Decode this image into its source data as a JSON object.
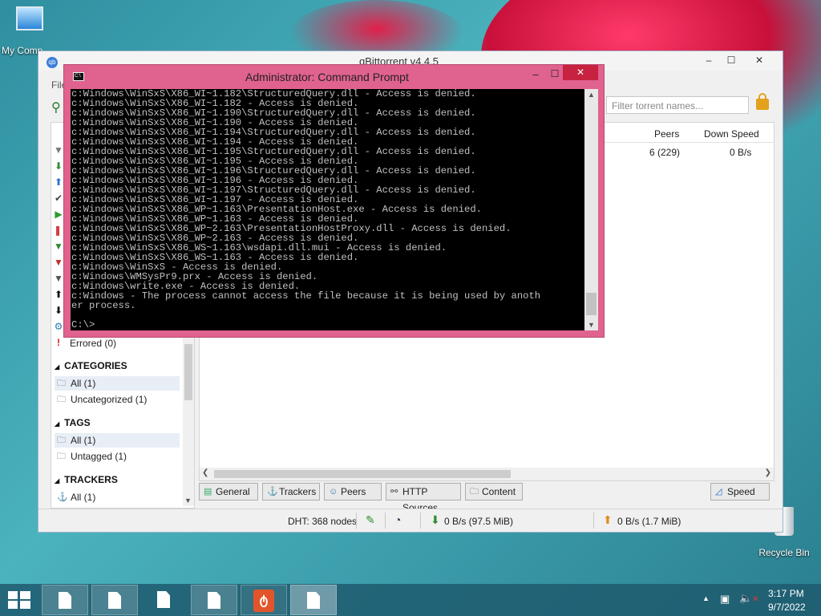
{
  "desktop": {
    "my_computer_label": "My Comp",
    "recycle_bin_label": "Recycle Bin"
  },
  "qbittorrent": {
    "title": "qBittorrent v4.4.5",
    "menu_file": "File",
    "filter_placeholder": "Filter torrent names...",
    "columns": {
      "peers": "Peers",
      "down_speed": "Down Speed"
    },
    "row": {
      "peers": "6 (229)",
      "down_speed": "0 B/s"
    },
    "status_filter_errored": "Errored (0)",
    "categories": {
      "header": "CATEGORIES",
      "items": [
        "All (1)",
        "Uncategorized (1)"
      ]
    },
    "tags": {
      "header": "TAGS",
      "items": [
        "All (1)",
        "Untagged (1)"
      ]
    },
    "trackers": {
      "header": "TRACKERS",
      "items": [
        "All (1)"
      ]
    },
    "tabs": [
      "General",
      "Trackers",
      "Peers",
      "HTTP Sources",
      "Content"
    ],
    "speed_button": "Speed",
    "status": {
      "dht": "DHT: 368 nodes",
      "download": "0 B/s (97.5 MiB)",
      "upload": "0 B/s (1.7 MiB)"
    },
    "colors": {
      "accent_download": "#2e8b2e",
      "accent_upload": "#e08a1e"
    }
  },
  "cmd": {
    "title": "Administrator: Command Prompt",
    "lines": [
      "c:Windows\\WinSxS\\X86_WI~1.182\\StructuredQuery.dll - Access is denied.",
      "c:Windows\\WinSxS\\X86_WI~1.182 - Access is denied.",
      "c:Windows\\WinSxS\\X86_WI~1.190\\StructuredQuery.dll - Access is denied.",
      "c:Windows\\WinSxS\\X86_WI~1.190 - Access is denied.",
      "c:Windows\\WinSxS\\X86_WI~1.194\\StructuredQuery.dll - Access is denied.",
      "c:Windows\\WinSxS\\X86_WI~1.194 - Access is denied.",
      "c:Windows\\WinSxS\\X86_WI~1.195\\StructuredQuery.dll - Access is denied.",
      "c:Windows\\WinSxS\\X86_WI~1.195 - Access is denied.",
      "c:Windows\\WinSxS\\X86_WI~1.196\\StructuredQuery.dll - Access is denied.",
      "c:Windows\\WinSxS\\X86_WI~1.196 - Access is denied.",
      "c:Windows\\WinSxS\\X86_WI~1.197\\StructuredQuery.dll - Access is denied.",
      "c:Windows\\WinSxS\\X86_WI~1.197 - Access is denied.",
      "c:Windows\\WinSxS\\X86_WP~1.163\\PresentationHost.exe - Access is denied.",
      "c:Windows\\WinSxS\\X86_WP~1.163 - Access is denied.",
      "c:Windows\\WinSxS\\X86_WP~2.163\\PresentationHostProxy.dll - Access is denied.",
      "c:Windows\\WinSxS\\X86_WP~2.163 - Access is denied.",
      "c:Windows\\WinSxS\\X86_WS~1.163\\wsdapi.dll.mui - Access is denied.",
      "c:Windows\\WinSxS\\X86_WS~1.163 - Access is denied.",
      "c:Windows\\WinSxS - Access is denied.",
      "c:Windows\\WMSysPr9.prx - Access is denied.",
      "c:Windows\\write.exe - Access is denied.",
      "c:Windows - The process cannot access the file because it is being used by anoth",
      "er process.",
      "",
      "C:\\>"
    ]
  },
  "taskbar": {
    "time": "3:17 PM",
    "date": "9/7/2022"
  }
}
